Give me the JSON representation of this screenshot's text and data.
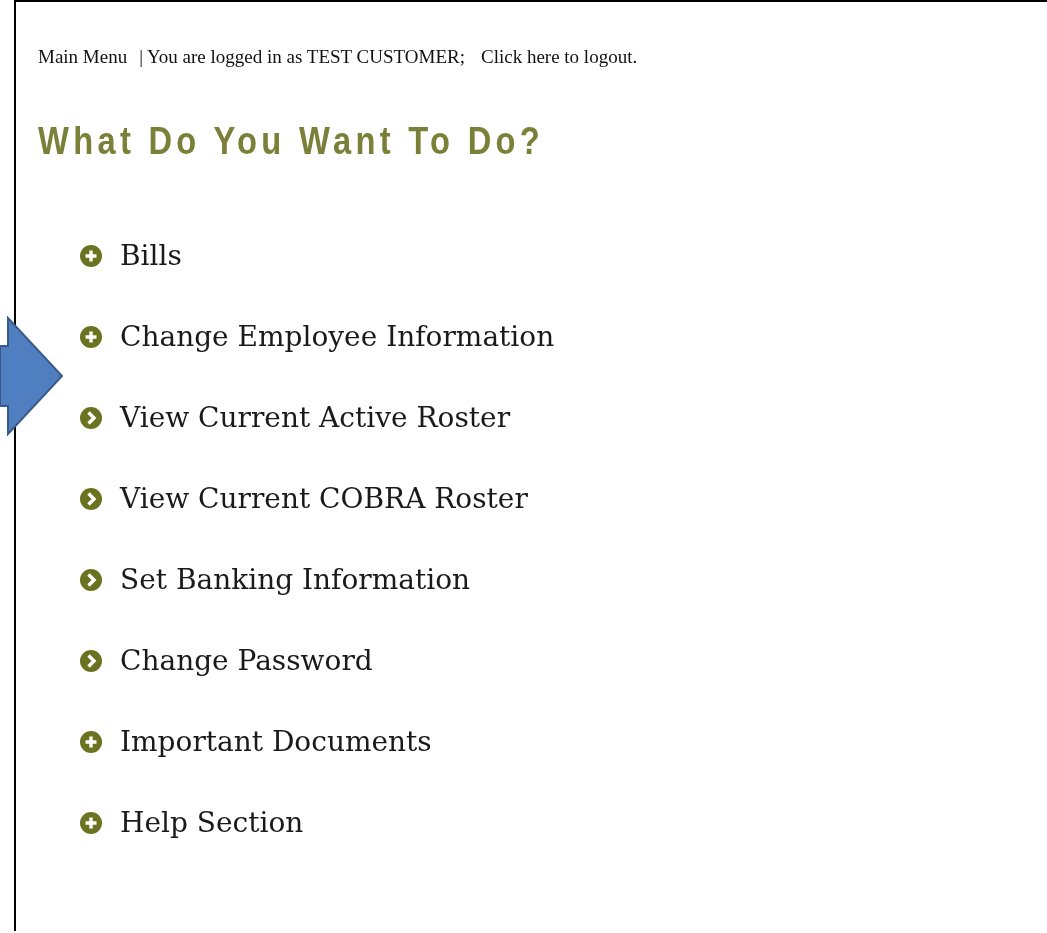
{
  "top_bar": {
    "main_menu": "Main Menu",
    "login_status": "| You are logged in as TEST CUSTOMER;",
    "logout_link": "Click here to logout."
  },
  "heading": "What Do You Want To Do?",
  "menu_items": [
    {
      "label": "Bills",
      "kind": "expand"
    },
    {
      "label": "Change Employee Information",
      "kind": "expand"
    },
    {
      "label": "View Current Active Roster",
      "kind": "link"
    },
    {
      "label": "View Current COBRA Roster",
      "kind": "link"
    },
    {
      "label": "Set Banking Information",
      "kind": "link"
    },
    {
      "label": "Change Password",
      "kind": "link"
    },
    {
      "label": "Important Documents",
      "kind": "expand"
    },
    {
      "label": "Help Section",
      "kind": "expand"
    }
  ]
}
